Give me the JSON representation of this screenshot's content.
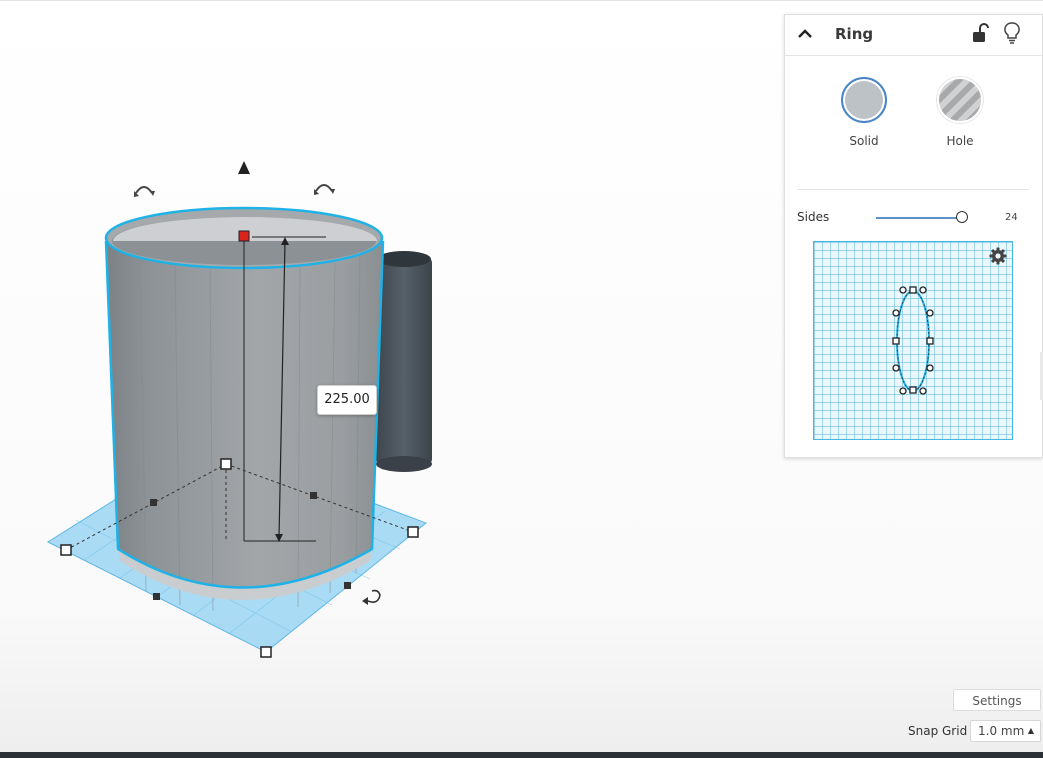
{
  "workplane": {
    "dimension_value": "225.00"
  },
  "inspector": {
    "title": "Ring",
    "solid_label": "Solid",
    "hole_label": "Hole",
    "sides_label": "Sides",
    "sides_value": "24",
    "sides_fraction": 0.95,
    "icons": [
      "chevron-up-icon",
      "unlock-icon",
      "lightbulb-icon",
      "gear-icon"
    ]
  },
  "footer": {
    "settings_label": "Settings",
    "snap_grid_label": "Snap Grid",
    "snap_grid_value": "1.0 mm"
  },
  "colors": {
    "selection": "#1fb2e6",
    "workplane_blue": "#7fc9ef",
    "shape_gray": "#8e9396",
    "active_handle": "#d9231c",
    "accent": "#4a86c7"
  }
}
